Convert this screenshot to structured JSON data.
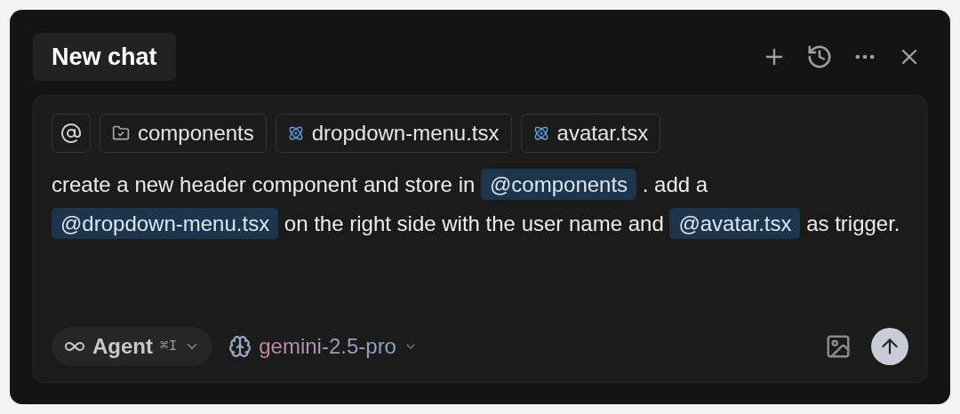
{
  "header": {
    "title": "New chat"
  },
  "context_chips": [
    {
      "kind": "folder",
      "label": "components"
    },
    {
      "kind": "react",
      "label": "dropdown-menu.tsx"
    },
    {
      "kind": "react",
      "label": "avatar.tsx"
    }
  ],
  "message": [
    {
      "kind": "text",
      "text": "create a new header component and store in "
    },
    {
      "kind": "mention",
      "text": "@components"
    },
    {
      "kind": "text",
      "text": " .  add a "
    },
    {
      "kind": "mention",
      "text": "@dropdown-menu.tsx"
    },
    {
      "kind": "text",
      "text": " on the right side with the user name and "
    },
    {
      "kind": "mention",
      "text": "@avatar.tsx"
    },
    {
      "kind": "text",
      "text": " as trigger."
    }
  ],
  "footer": {
    "mode": {
      "label": "Agent",
      "shortcut": "⌘I"
    },
    "model": {
      "label": "gemini-2.5-pro"
    }
  }
}
